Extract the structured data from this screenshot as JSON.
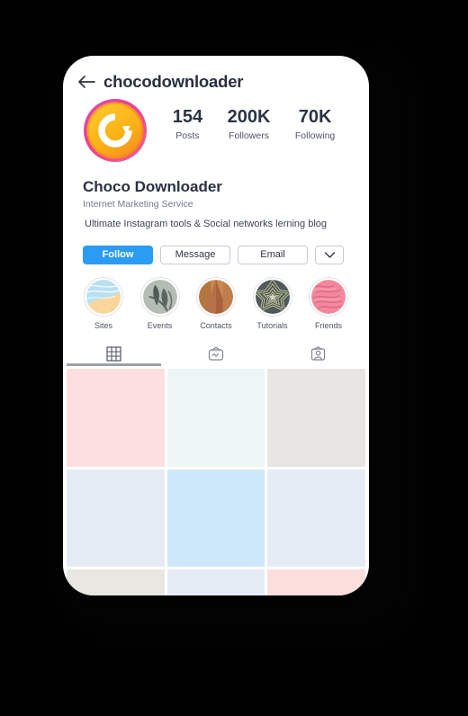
{
  "background_color": "#000000",
  "card": {
    "background": "#ffffff"
  },
  "header": {
    "back_icon": "arrow-left-icon",
    "handle": "chocodownloader"
  },
  "profile": {
    "avatar": {
      "icon": "refresh-logo-icon",
      "ring_outer_color": "#e9459a",
      "ring_inner_color": "#f7921e",
      "disc_top_color": "#fbc02d",
      "disc_bottom_color": "#f79a23"
    },
    "stats": [
      {
        "value": "154",
        "label": "Posts"
      },
      {
        "value": "200K",
        "label": "Followers"
      },
      {
        "value": "70K",
        "label": "Following"
      }
    ],
    "name": "Choco Downloader",
    "category": "Internet Marketing Service",
    "description": "Ultimate Instagram tools & Social networks lerning blog"
  },
  "actions": {
    "follow": {
      "label": "Follow",
      "color": "#2b9bf4",
      "text_color": "#ffffff"
    },
    "message": {
      "label": "Message"
    },
    "email": {
      "label": "Email"
    },
    "more": {
      "icon": "chevron-down-icon"
    }
  },
  "highlights": [
    {
      "label": "Sites",
      "theme": "beach"
    },
    {
      "label": "Events",
      "theme": "leaves"
    },
    {
      "label": "Contacts",
      "theme": "mountains"
    },
    {
      "label": "Tutorials",
      "theme": "star"
    },
    {
      "label": "Friends",
      "theme": "waves"
    }
  ],
  "tabs": [
    {
      "icon": "grid-icon",
      "active": true
    },
    {
      "icon": "igtv-icon",
      "active": false
    },
    {
      "icon": "tagged-user-icon",
      "active": false
    }
  ],
  "grid": {
    "cells": [
      {
        "color": "#fcdfde"
      },
      {
        "color": "#ecf6f4"
      },
      {
        "color": "#e8e6e2"
      },
      {
        "color": "#e4ebf4"
      },
      {
        "color": "#cde7fb"
      },
      {
        "color": "#e6ecf5"
      },
      {
        "color": "#e8e7e2"
      },
      {
        "color": "#e5ecf5"
      },
      {
        "color": "#fcdedd"
      }
    ]
  }
}
